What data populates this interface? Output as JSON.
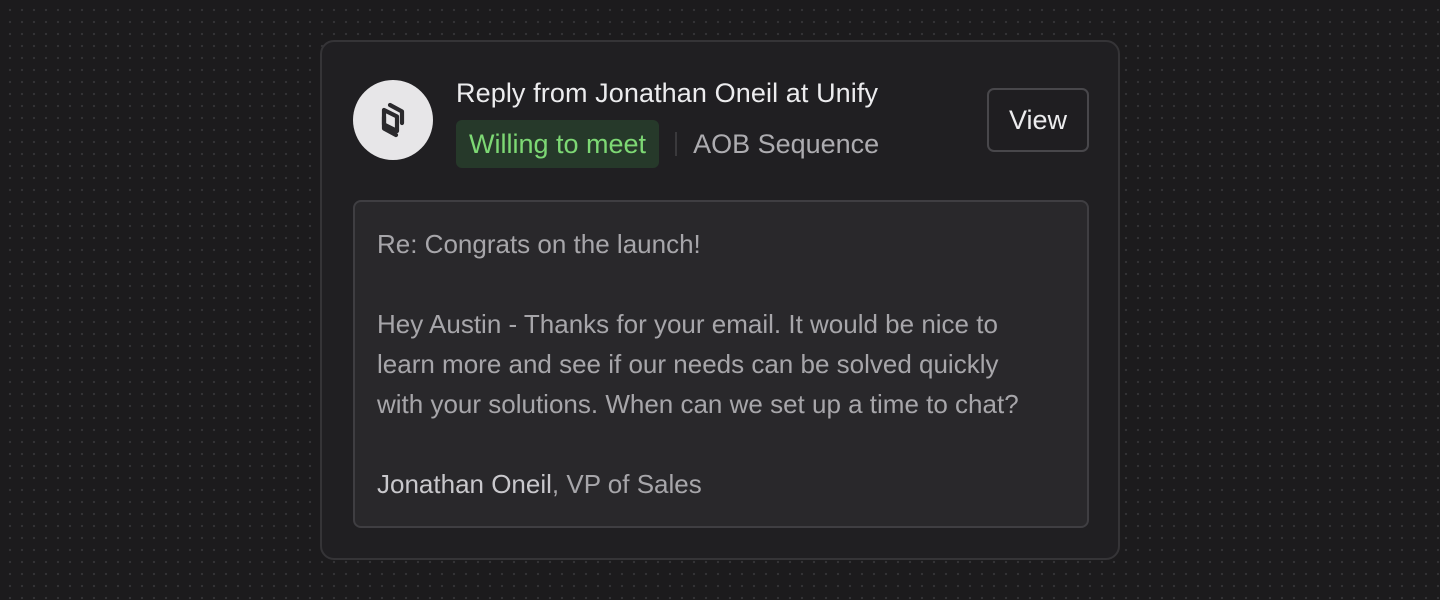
{
  "notification": {
    "title": "Reply from Jonathan Oneil at Unify",
    "status_badge": "Willing to meet",
    "sequence": "AOB Sequence",
    "view_label": "View",
    "avatar_icon": "unify-logo-icon"
  },
  "email": {
    "subject": "Re: Congrats on the launch!",
    "body_lines": [
      "Hey Austin - Thanks for your email. It would be nice to",
      "learn more and see if our needs can be solved quickly",
      "with your solutions. When can we set up a time to chat?"
    ],
    "signature_name": "Jonathan Oneil",
    "signature_title": ", VP of Sales"
  },
  "colors": {
    "badge_text": "#7dd874",
    "badge_bg": "#26392a",
    "card_bg": "#201f22",
    "page_bg": "#1c1b1d"
  }
}
